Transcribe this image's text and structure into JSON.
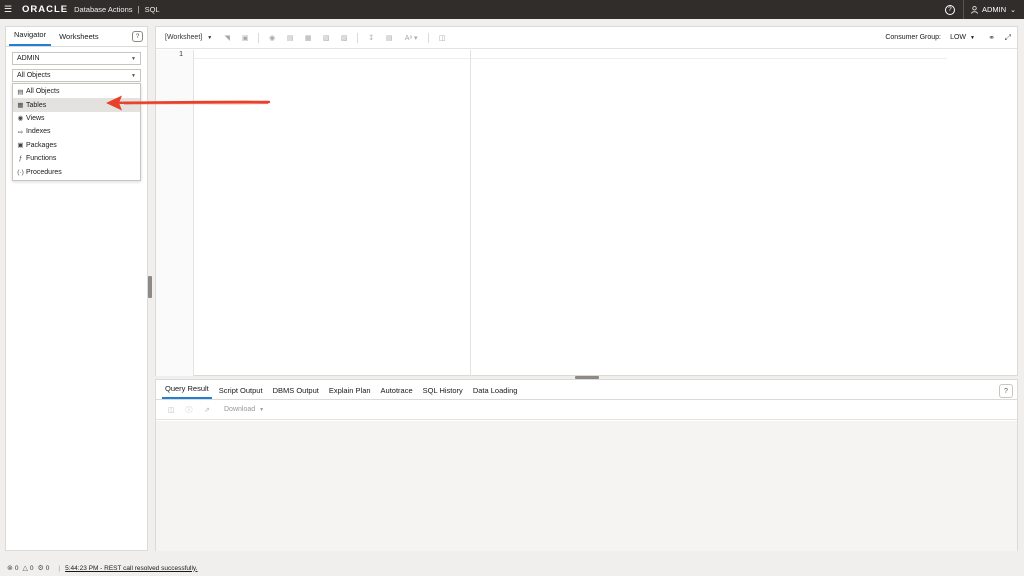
{
  "header": {
    "menu_icon": "hamburger-icon",
    "logo": "ORACLE",
    "app_name": "Database Actions",
    "separator": "|",
    "section": "SQL",
    "help_icon": "help-icon",
    "user_label": "ADMIN",
    "user_icon": "user-icon"
  },
  "navigator": {
    "tabs": [
      {
        "label": "Navigator",
        "active": true
      },
      {
        "label": "Worksheets",
        "active": false
      }
    ],
    "schema_value": "ADMIN",
    "object_type_value": "All Objects",
    "object_types": [
      {
        "label": "All Objects",
        "icon": "document-icon",
        "selected": false
      },
      {
        "label": "Tables",
        "icon": "table-icon",
        "selected": true
      },
      {
        "label": "Views",
        "icon": "eye-icon",
        "selected": false
      },
      {
        "label": "Indexes",
        "icon": "index-icon",
        "selected": false
      },
      {
        "label": "Packages",
        "icon": "package-icon",
        "selected": false
      },
      {
        "label": "Functions",
        "icon": "function-icon",
        "selected": false
      },
      {
        "label": "Procedures",
        "icon": "procedure-icon",
        "selected": false
      }
    ]
  },
  "editor": {
    "worksheet_label": "[Worksheet]",
    "consumer_group_label": "Consumer Group:",
    "consumer_group_value": "LOW",
    "line_number": "1"
  },
  "results": {
    "tabs": [
      {
        "label": "Query Result",
        "active": true
      },
      {
        "label": "Script Output",
        "active": false
      },
      {
        "label": "DBMS Output",
        "active": false
      },
      {
        "label": "Explain Plan",
        "active": false
      },
      {
        "label": "Autotrace",
        "active": false
      },
      {
        "label": "SQL History",
        "active": false
      },
      {
        "label": "Data Loading",
        "active": false
      }
    ],
    "download_label": "Download"
  },
  "status": {
    "errors": "0",
    "warnings": "0",
    "tasks": "0",
    "message": "5:44:23 PM - REST call resolved successfully."
  },
  "colors": {
    "header_bg": "#312d2a",
    "accent": "#227fd2",
    "annotation_arrow": "#e8402a"
  }
}
